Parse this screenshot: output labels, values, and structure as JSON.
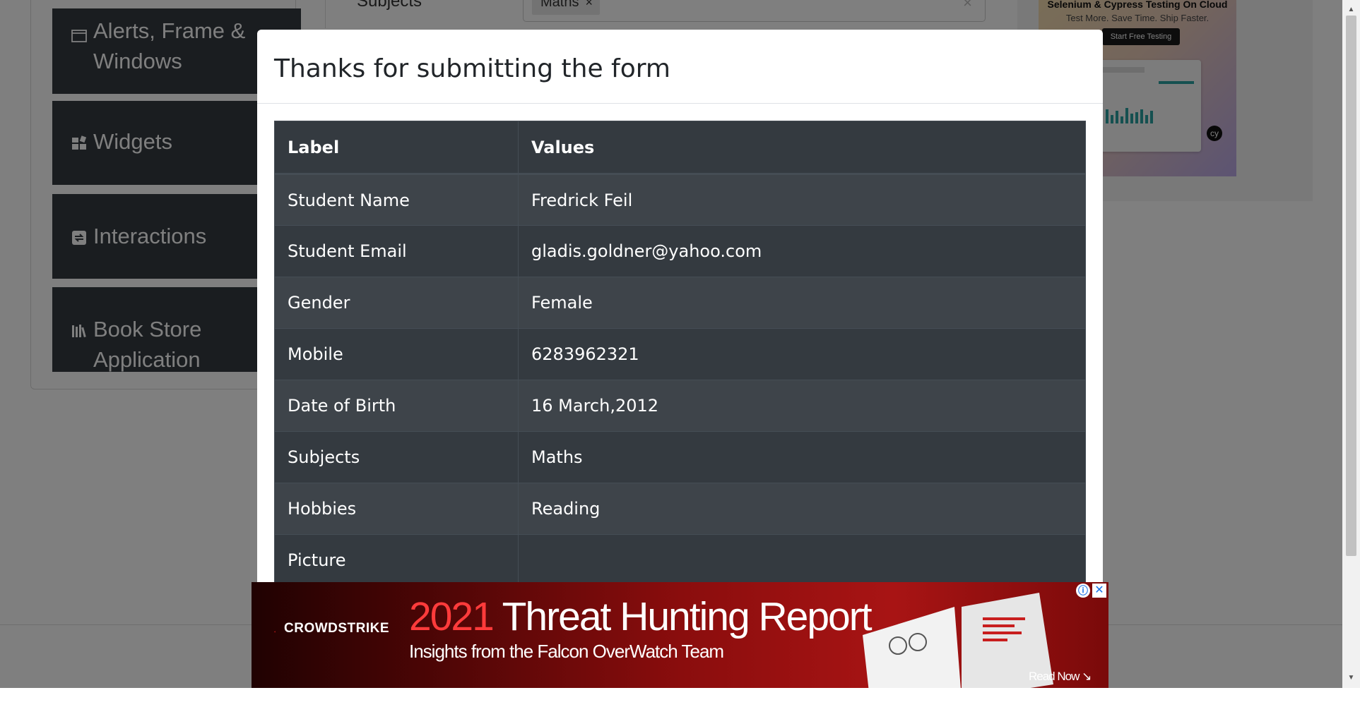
{
  "background": {
    "sidebar": {
      "items": [
        {
          "label_line1": "Alerts, Frame &",
          "label_line2": "Windows",
          "icon": "window-icon"
        },
        {
          "label": "Widgets",
          "icon": "widgets-icon"
        },
        {
          "label": "Interactions",
          "icon": "interactions-icon"
        },
        {
          "label_line1": "Book Store",
          "label_line2": "Application",
          "icon": "books-icon"
        }
      ]
    },
    "form": {
      "subjects_label": "Subjects",
      "subject_chip": "Maths",
      "chip_remove": "×",
      "clear_icon": "×"
    },
    "side_ad": {
      "headline": "Selenium & Cypress Testing On Cloud",
      "subline": "Test More. Save Time. Ship Faster.",
      "button": "Start Free Testing",
      "badge": "cy"
    }
  },
  "modal": {
    "title": "Thanks for submitting the form",
    "table": {
      "headers": [
        "Label",
        "Values"
      ],
      "rows": [
        {
          "label": "Student Name",
          "value": "Fredrick Feil"
        },
        {
          "label": "Student Email",
          "value": "gladis.goldner@yahoo.com"
        },
        {
          "label": "Gender",
          "value": "Female"
        },
        {
          "label": "Mobile",
          "value": "6283962321"
        },
        {
          "label": "Date of Birth",
          "value": "16 March,2012"
        },
        {
          "label": "Subjects",
          "value": "Maths"
        },
        {
          "label": "Hobbies",
          "value": "Reading"
        },
        {
          "label": "Picture",
          "value": ""
        }
      ]
    }
  },
  "bottom_ad": {
    "brand": "CROWDSTRIKE",
    "headline_year": "2021",
    "headline_rest": " Threat Hunting Report",
    "subline": "Insights from the Falcon OverWatch Team",
    "cta": "Read Now",
    "info_icon": "ⓘ",
    "close_icon": "✕"
  },
  "colors": {
    "table_dark": "#343a40",
    "table_stripe": "#3e444a",
    "overlay": "rgba(0,0,0,0.5)",
    "ad_accent": "#ff3b3b"
  }
}
